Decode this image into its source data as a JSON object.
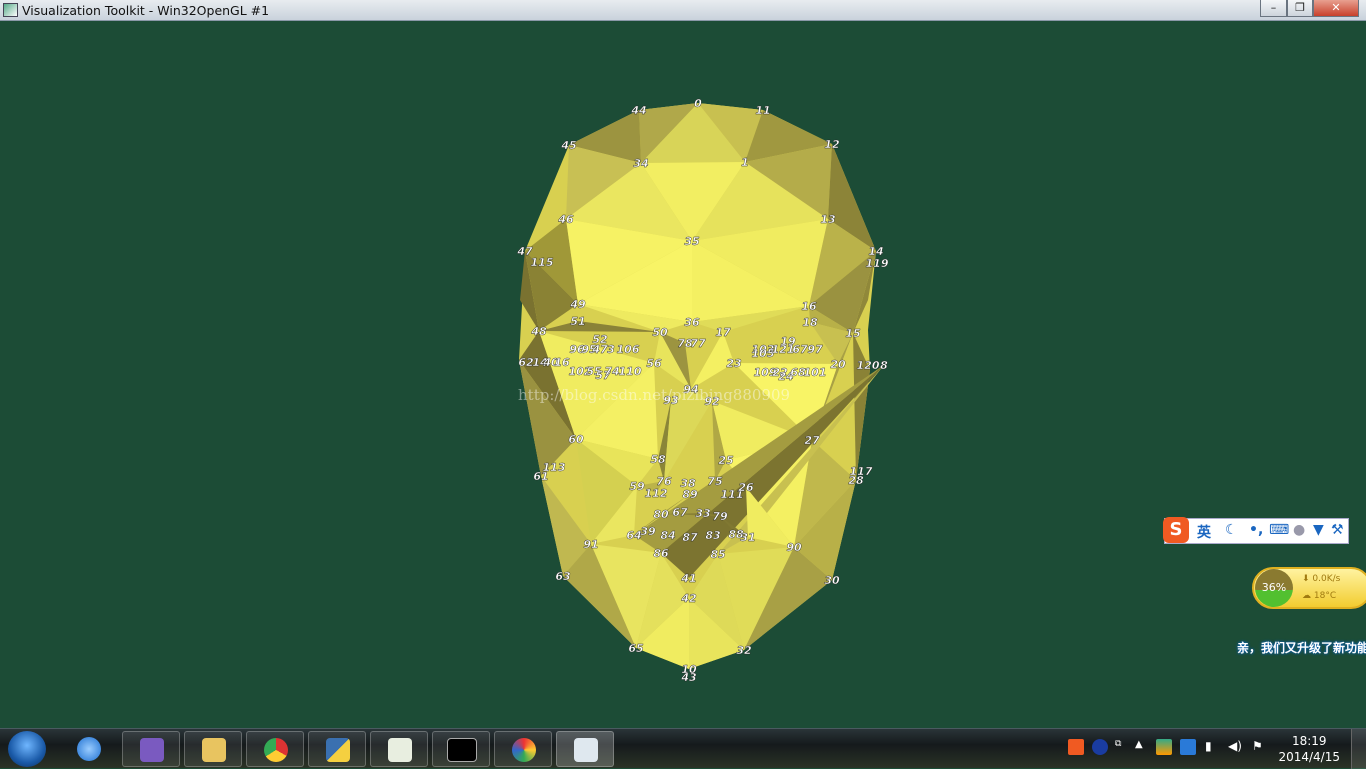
{
  "window": {
    "title": "Visualization Toolkit - Win32OpenGL #1",
    "minimize": "–",
    "maximize": "❐",
    "close": "✕"
  },
  "watermark": "http://blog.csdn.net/pizibing880909",
  "mesh": {
    "fill_colors": {
      "bright": "#f5f060",
      "mid": "#d8d050",
      "dark": "#9a9040",
      "darker": "#7a7030"
    },
    "labels": [
      "0",
      "11",
      "44",
      "12",
      "45",
      "34",
      "1",
      "46",
      "13",
      "35",
      "47",
      "115",
      "14",
      "119",
      "49",
      "16",
      "51",
      "18",
      "50",
      "36",
      "17",
      "15",
      "48",
      "52",
      "19",
      "78",
      "77",
      "23",
      "56",
      "20",
      "62",
      "120",
      "8",
      "94",
      "93",
      "92",
      "60",
      "27",
      "58",
      "25",
      "113",
      "61",
      "117",
      "28",
      "59",
      "76",
      "38",
      "75",
      "112",
      "89",
      "111",
      "26",
      "80",
      "67",
      "33",
      "79",
      "64",
      "39",
      "84",
      "87",
      "83",
      "88",
      "31",
      "91",
      "90",
      "86",
      "85",
      "41",
      "63",
      "30",
      "42",
      "65",
      "32",
      "10",
      "43",
      "96",
      "95",
      "47",
      "3",
      "106",
      "102",
      "55",
      "57",
      "74",
      "110",
      "14",
      "40",
      "16",
      "103",
      "105",
      "121",
      "67",
      "97",
      "109",
      "22",
      "24",
      "68",
      "101"
    ]
  },
  "ime": {
    "logo": "S",
    "mode": "英",
    "icons": [
      "moon-icon",
      "punctuation-icon",
      "keyboard-icon",
      "user-icon",
      "skin-icon",
      "settings-wrench-icon"
    ]
  },
  "widget": {
    "percent": "36%",
    "speed": "0.0K/s",
    "temperature": "18°C"
  },
  "promo": "亲，我们又升级了新功能",
  "taskbar": {
    "apps": [
      "ie",
      "visual-studio",
      "file-explorer",
      "chrome",
      "python",
      "notepad",
      "cmd",
      "paint",
      "vtk-window"
    ]
  },
  "tray": {
    "time": "18:19",
    "date": "2014/4/15"
  }
}
